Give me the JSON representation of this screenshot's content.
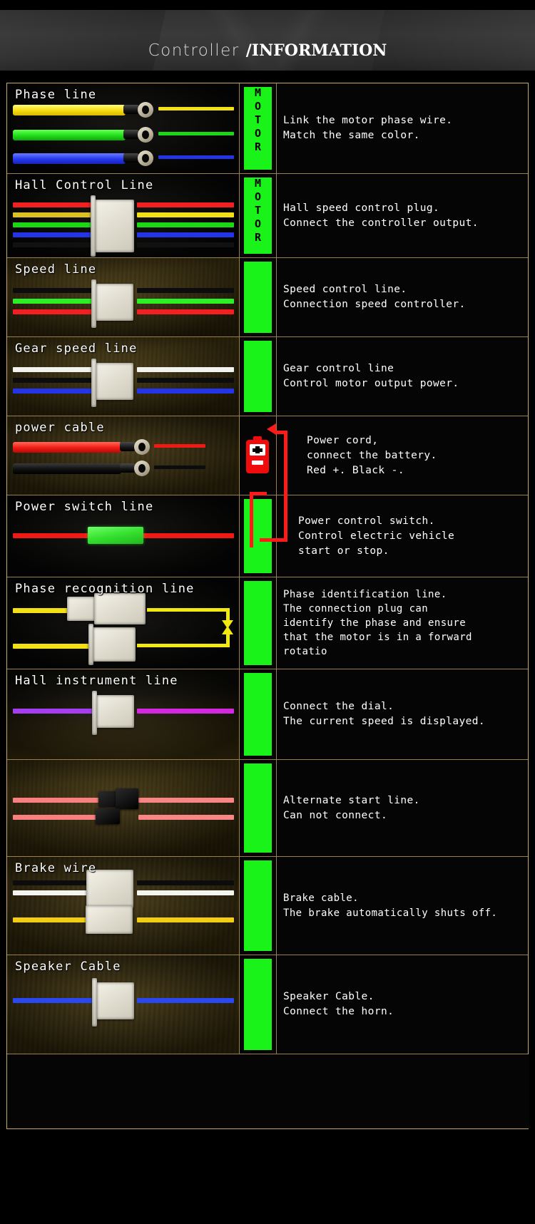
{
  "header": {
    "title_light": "Controller",
    "slash": "/",
    "title_bold": "INFORMATION"
  },
  "colors": {
    "accent_green": "#19f319",
    "border": "#c9a96a",
    "battery_red": "#f00c0c",
    "arrow_yellow": "#f2e812",
    "text": "#ffffff"
  },
  "table": {
    "rows": [
      {
        "label": "Phase line",
        "badge": "MOTOR",
        "badge_chars": [
          "M",
          "O",
          "T",
          "O",
          "R"
        ],
        "description": [
          "Link the motor phase wire.",
          "Match the same color."
        ],
        "wires": [
          "yellow",
          "green",
          "blue"
        ],
        "connector": "ring-lug"
      },
      {
        "label": "Hall Control Line",
        "badge": "MOTOR",
        "badge_chars": [
          "M",
          "O",
          "T",
          "O",
          "R"
        ],
        "description": [
          "Hall speed control plug.",
          "Connect the controller output."
        ],
        "wires": [
          "red",
          "yellow",
          "green",
          "blue",
          "black"
        ],
        "connector": "white-plug"
      },
      {
        "label": "Speed line",
        "badge": "",
        "badge_chars": [],
        "description": [
          "Speed control line.",
          "Connection speed controller."
        ],
        "wires": [
          "black",
          "green",
          "red"
        ],
        "connector": "white-plug"
      },
      {
        "label": "Gear speed line",
        "badge": "",
        "badge_chars": [],
        "description": [
          "Gear control line",
          "Control motor output power."
        ],
        "wires": [
          "white",
          "black",
          "blue"
        ],
        "connector": "white-plug"
      },
      {
        "label": "power cable",
        "badge": "",
        "badge_chars": [],
        "description": [
          "Power cord,",
          "  connect the battery.",
          "Red +.  Black -."
        ],
        "wires": [
          "red",
          "black"
        ],
        "connector": "ring-lug",
        "icon": "battery-icon",
        "battery_plus": "+",
        "battery_minus": "-"
      },
      {
        "label": "Power switch line",
        "badge": "",
        "badge_chars": [],
        "description": [
          "Power control switch.",
          "Control electric vehicle",
          "start or stop."
        ],
        "wires": [
          "red"
        ],
        "connector": "green-switch"
      },
      {
        "label": "Phase recognition line",
        "badge": "",
        "badge_chars": [],
        "description": [
          "Phase identification line.",
          "The connection plug can",
          "identify the phase and ensure",
          "that the motor is in a forward",
          "rotatio"
        ],
        "wires": [
          "yellow",
          "yellow"
        ],
        "connector": "white-plug-pair"
      },
      {
        "label": "Hall instrument line",
        "badge": "",
        "badge_chars": [],
        "description": [
          "Connect the dial.",
          "The current speed is displayed."
        ],
        "wires": [
          "purple"
        ],
        "connector": "white-plug"
      },
      {
        "label": "",
        "badge": "",
        "badge_chars": [],
        "description": [
          "Alternate start line.",
          "Can not connect."
        ],
        "wires": [
          "pink",
          "pink"
        ],
        "connector": "black-plug-pair"
      },
      {
        "label": "Brake wire",
        "badge": "",
        "badge_chars": [],
        "description": [
          "Brake cable.",
          "The brake automatically shuts off."
        ],
        "wires": [
          "black",
          "white",
          "yellow"
        ],
        "connector": "white-plug-pair"
      },
      {
        "label": "Speaker Cable",
        "badge": "",
        "badge_chars": [],
        "description": [
          "Speaker Cable.",
          "Connect the horn."
        ],
        "wires": [
          "blue"
        ],
        "connector": "white-plug"
      },
      {
        "label": "",
        "badge": "",
        "badge_chars": [],
        "description": [],
        "wires": [],
        "connector": "none"
      }
    ]
  }
}
